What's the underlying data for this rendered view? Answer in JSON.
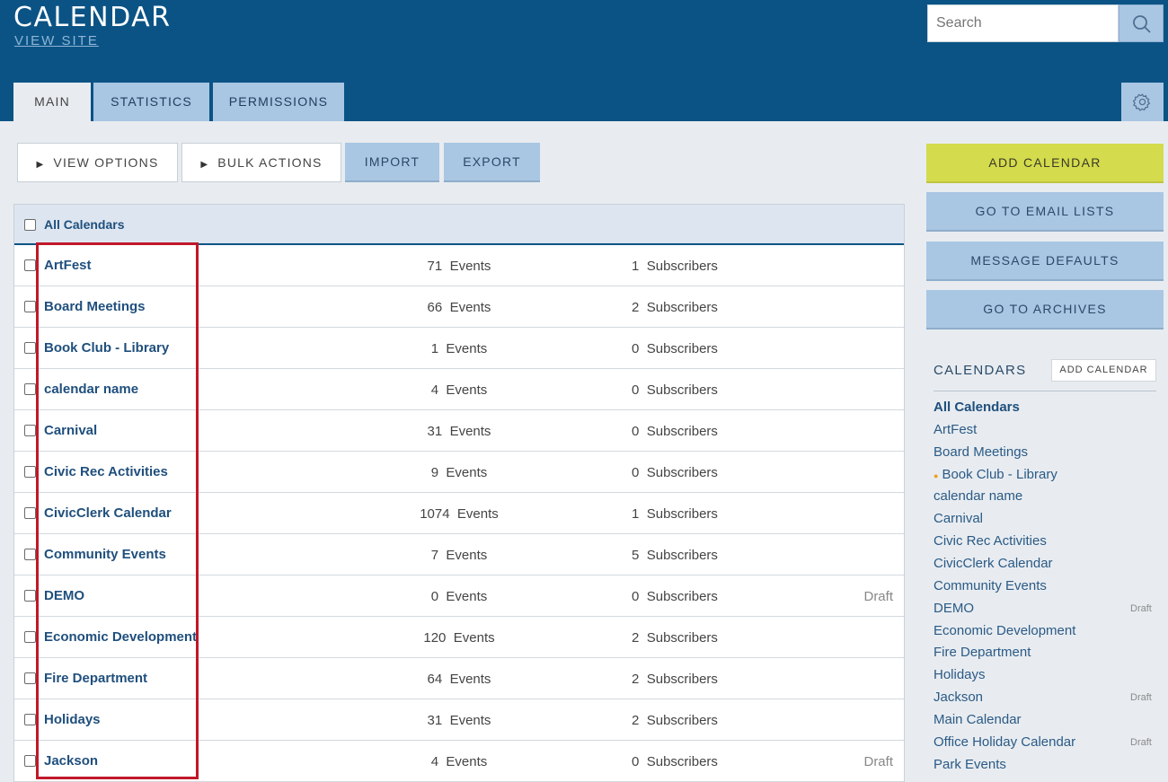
{
  "header": {
    "title": "CALENDAR",
    "view_site": "VIEW SITE",
    "search_placeholder": "Search"
  },
  "tabs": [
    {
      "label": "MAIN",
      "active": true
    },
    {
      "label": "STATISTICS",
      "active": false
    },
    {
      "label": "PERMISSIONS",
      "active": false
    }
  ],
  "toolbar": {
    "view_options": "VIEW OPTIONS",
    "bulk_actions": "BULK ACTIONS",
    "import": "IMPORT",
    "export": "EXPORT"
  },
  "table": {
    "header_label": "All Calendars",
    "events_suffix": "Events",
    "subscribers_suffix": "Subscribers",
    "rows": [
      {
        "name": "ArtFest",
        "events": "71",
        "subscribers": "1",
        "status": ""
      },
      {
        "name": "Board Meetings",
        "events": "66",
        "subscribers": "2",
        "status": ""
      },
      {
        "name": "Book Club - Library",
        "events": "1",
        "subscribers": "0",
        "status": ""
      },
      {
        "name": "calendar name",
        "events": "4",
        "subscribers": "0",
        "status": ""
      },
      {
        "name": "Carnival",
        "events": "31",
        "subscribers": "0",
        "status": ""
      },
      {
        "name": "Civic Rec Activities",
        "events": "9",
        "subscribers": "0",
        "status": ""
      },
      {
        "name": "CivicClerk Calendar",
        "events": "1074",
        "subscribers": "1",
        "status": ""
      },
      {
        "name": "Community Events",
        "events": "7",
        "subscribers": "5",
        "status": ""
      },
      {
        "name": "DEMO",
        "events": "0",
        "subscribers": "0",
        "status": "Draft"
      },
      {
        "name": "Economic Development",
        "events": "120",
        "subscribers": "2",
        "status": ""
      },
      {
        "name": "Fire Department",
        "events": "64",
        "subscribers": "2",
        "status": ""
      },
      {
        "name": "Holidays",
        "events": "31",
        "subscribers": "2",
        "status": ""
      },
      {
        "name": "Jackson",
        "events": "4",
        "subscribers": "0",
        "status": "Draft"
      }
    ]
  },
  "sidebar": {
    "buttons": {
      "add_calendar": "ADD CALENDAR",
      "email_lists": "GO TO EMAIL LISTS",
      "message_defaults": "MESSAGE DEFAULTS",
      "archives": "GO TO ARCHIVES"
    },
    "calendars_heading": "CALENDARS",
    "calendars_add": "ADD CALENDAR",
    "items": [
      {
        "label": "All Calendars",
        "status": ""
      },
      {
        "label": "ArtFest",
        "status": ""
      },
      {
        "label": "Board Meetings",
        "status": ""
      },
      {
        "label": "Book Club - Library",
        "status": ""
      },
      {
        "label": "calendar name",
        "status": ""
      },
      {
        "label": "Carnival",
        "status": ""
      },
      {
        "label": "Civic Rec Activities",
        "status": ""
      },
      {
        "label": "CivicClerk Calendar",
        "status": ""
      },
      {
        "label": "Community Events",
        "status": ""
      },
      {
        "label": "DEMO",
        "status": "Draft"
      },
      {
        "label": "Economic Development",
        "status": ""
      },
      {
        "label": "Fire Department",
        "status": ""
      },
      {
        "label": "Holidays",
        "status": ""
      },
      {
        "label": "Jackson",
        "status": "Draft"
      },
      {
        "label": "Main Calendar",
        "status": ""
      },
      {
        "label": "Office Holiday Calendar",
        "status": "Draft"
      },
      {
        "label": "Park Events",
        "status": ""
      }
    ]
  },
  "colors": {
    "header_bg": "#0b5385",
    "tab_bg": "#a9c6e3",
    "add_calendar_bg": "#d4db4c",
    "highlight_border": "#c0182a",
    "link_color": "#1f4f7d",
    "dot_color": "#f29b1d"
  }
}
